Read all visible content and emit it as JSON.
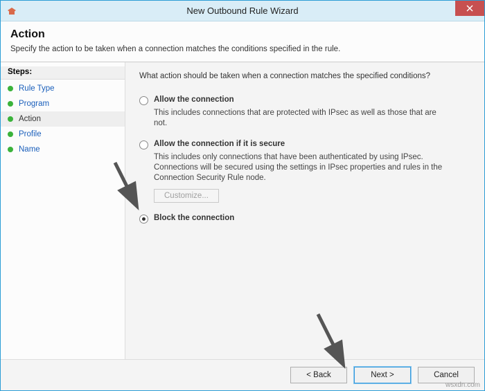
{
  "window": {
    "title": "New Outbound Rule Wizard"
  },
  "header": {
    "title": "Action",
    "subtitle": "Specify the action to be taken when a connection matches the conditions specified in the rule."
  },
  "sidebar": {
    "title": "Steps:",
    "items": [
      {
        "label": "Rule Type",
        "active": false
      },
      {
        "label": "Program",
        "active": false
      },
      {
        "label": "Action",
        "active": true
      },
      {
        "label": "Profile",
        "active": false
      },
      {
        "label": "Name",
        "active": false
      }
    ]
  },
  "content": {
    "prompt": "What action should be taken when a connection matches the specified conditions?",
    "options": [
      {
        "label": "Allow the connection",
        "desc": "This includes connections that are protected with IPsec as well as those that are not.",
        "checked": false
      },
      {
        "label": "Allow the connection if it is secure",
        "desc": "This includes only connections that have been authenticated by using IPsec. Connections will be secured using the settings in IPsec properties and rules in the Connection Security Rule node.",
        "checked": false
      },
      {
        "label": "Block the connection",
        "desc": "",
        "checked": true
      }
    ],
    "customize_label": "Customize..."
  },
  "footer": {
    "back": "< Back",
    "next": "Next >",
    "cancel": "Cancel"
  },
  "watermark": "wsxdn.com"
}
